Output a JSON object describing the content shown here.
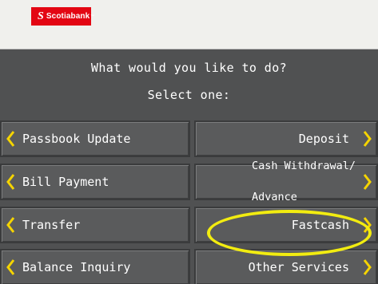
{
  "header": {
    "brand": "Scotiabank",
    "brand_mark": "S",
    "trademark": "™"
  },
  "prompt": {
    "question": "What would you like to do?",
    "instruction": "Select one:"
  },
  "buttons": {
    "passbook_update": "Passbook Update",
    "deposit": "Deposit",
    "bill_payment": "Bill Payment",
    "cash_withdrawal_line1": "Cash Withdrawal/",
    "cash_withdrawal_line2": "Advance",
    "transfer": "Transfer",
    "fastcash": "Fastcash",
    "balance_inquiry": "Balance Inquiry",
    "other_services": "Other Services"
  },
  "icons": {
    "left_arrow": "chevron-left-icon",
    "right_arrow": "chevron-right-icon"
  },
  "colors": {
    "brand_red": "#e30613",
    "arrow_yellow": "#f5d400",
    "highlight_yellow": "#f2ec10",
    "screen_bg": "#505152"
  }
}
